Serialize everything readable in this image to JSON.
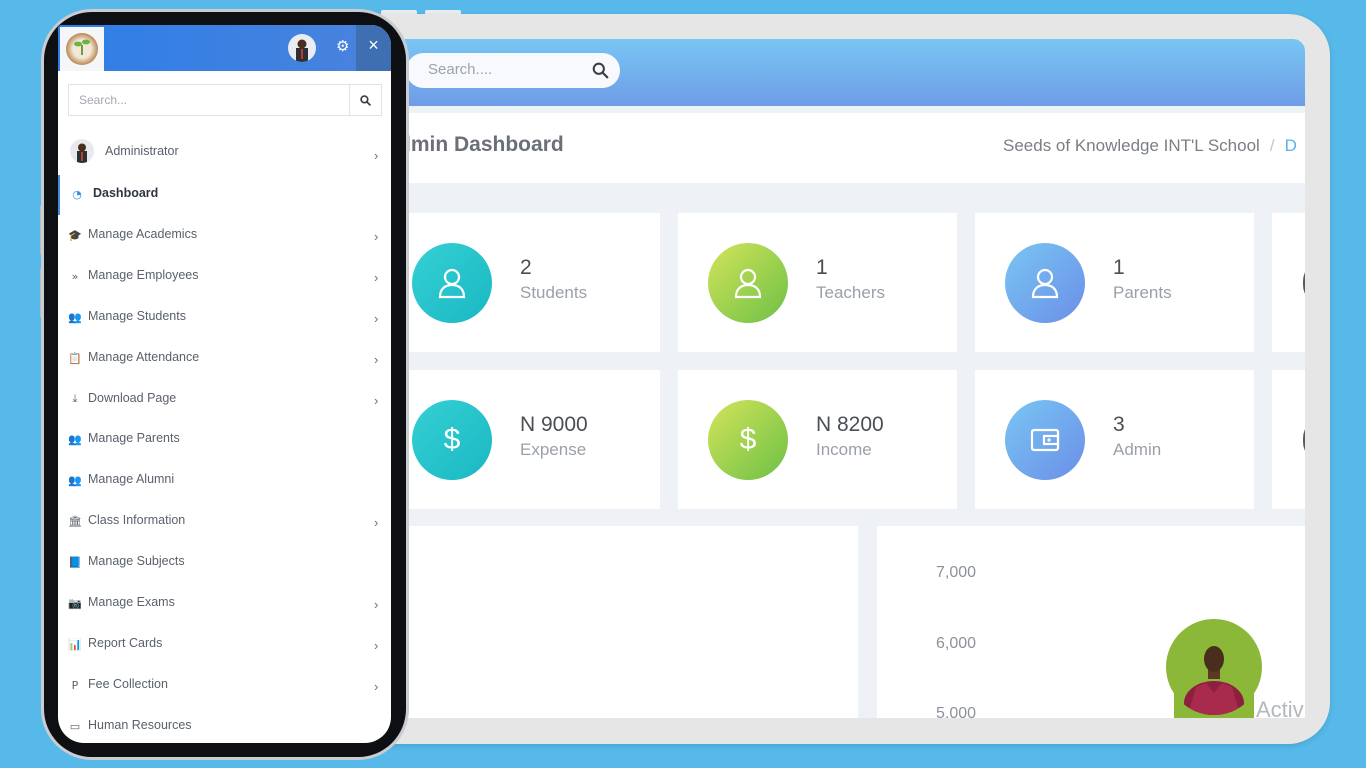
{
  "colors": {
    "background": "#56b9e9",
    "accent": "#3f8ee0",
    "teal": "#1ab8c4",
    "green": "#6cc046",
    "blue": "#6b8ee8"
  },
  "topbar": {
    "search_placeholder": "Search....",
    "search_icon": "search-icon"
  },
  "header": {
    "title": "lmin Dashboard",
    "breadcrumb": {
      "school": "Seeds of Knowledge INT'L School",
      "separator": "/",
      "current": "D"
    }
  },
  "stats": [
    {
      "value": "2",
      "label": "Students",
      "icon": "user-icon"
    },
    {
      "value": "1",
      "label": "Teachers",
      "icon": "user-icon"
    },
    {
      "value": "1",
      "label": "Parents",
      "icon": "user-icon"
    },
    {
      "value": "N 9000",
      "label": "Expense",
      "icon": "dollar-icon"
    },
    {
      "value": "N 8200",
      "label": "Income",
      "icon": "dollar-icon"
    },
    {
      "value": "3",
      "label": "Admin",
      "icon": "wallet-icon"
    }
  ],
  "chart_data": {
    "type": "bar",
    "y_ticks": [
      "7,000",
      "6,000",
      "5,000"
    ],
    "title": ""
  },
  "watermark": {
    "text": "Activ"
  },
  "sidebar": {
    "search_placeholder": "Search...",
    "close_label": "×",
    "user": {
      "name": "Administrator"
    },
    "items": [
      {
        "label": "Dashboard",
        "icon": "dashboard-icon",
        "glyph": "◔",
        "active": true,
        "chevron": false
      },
      {
        "label": "Manage Academics",
        "icon": "graduation-cap-icon",
        "glyph": "🎓",
        "active": false,
        "chevron": true
      },
      {
        "label": "Manage Employees",
        "icon": "double-chevron-icon",
        "glyph": "»",
        "active": false,
        "chevron": true
      },
      {
        "label": "Manage Students",
        "icon": "users-icon",
        "glyph": "👥",
        "active": false,
        "chevron": true
      },
      {
        "label": "Manage Attendance",
        "icon": "clipboard-icon",
        "glyph": "📋",
        "active": false,
        "chevron": true
      },
      {
        "label": "Download Page",
        "icon": "download-icon",
        "glyph": "⤓",
        "active": false,
        "chevron": true
      },
      {
        "label": "Manage Parents",
        "icon": "users-icon",
        "glyph": "👥",
        "active": false,
        "chevron": false
      },
      {
        "label": "Manage Alumni",
        "icon": "users-icon",
        "glyph": "👥",
        "active": false,
        "chevron": false
      },
      {
        "label": "Class Information",
        "icon": "institution-icon",
        "glyph": "🏛",
        "active": false,
        "chevron": true
      },
      {
        "label": "Manage Subjects",
        "icon": "book-icon",
        "glyph": "📘",
        "active": false,
        "chevron": false
      },
      {
        "label": "Manage Exams",
        "icon": "camera-icon",
        "glyph": "📷",
        "active": false,
        "chevron": true
      },
      {
        "label": "Report Cards",
        "icon": "bar-chart-icon",
        "glyph": "📊",
        "active": false,
        "chevron": true
      },
      {
        "label": "Fee Collection",
        "icon": "paypal-icon",
        "glyph": "P",
        "active": false,
        "chevron": true
      },
      {
        "label": "Human Resources",
        "icon": "credit-card-icon",
        "glyph": "▭",
        "active": false,
        "chevron": false
      }
    ]
  }
}
